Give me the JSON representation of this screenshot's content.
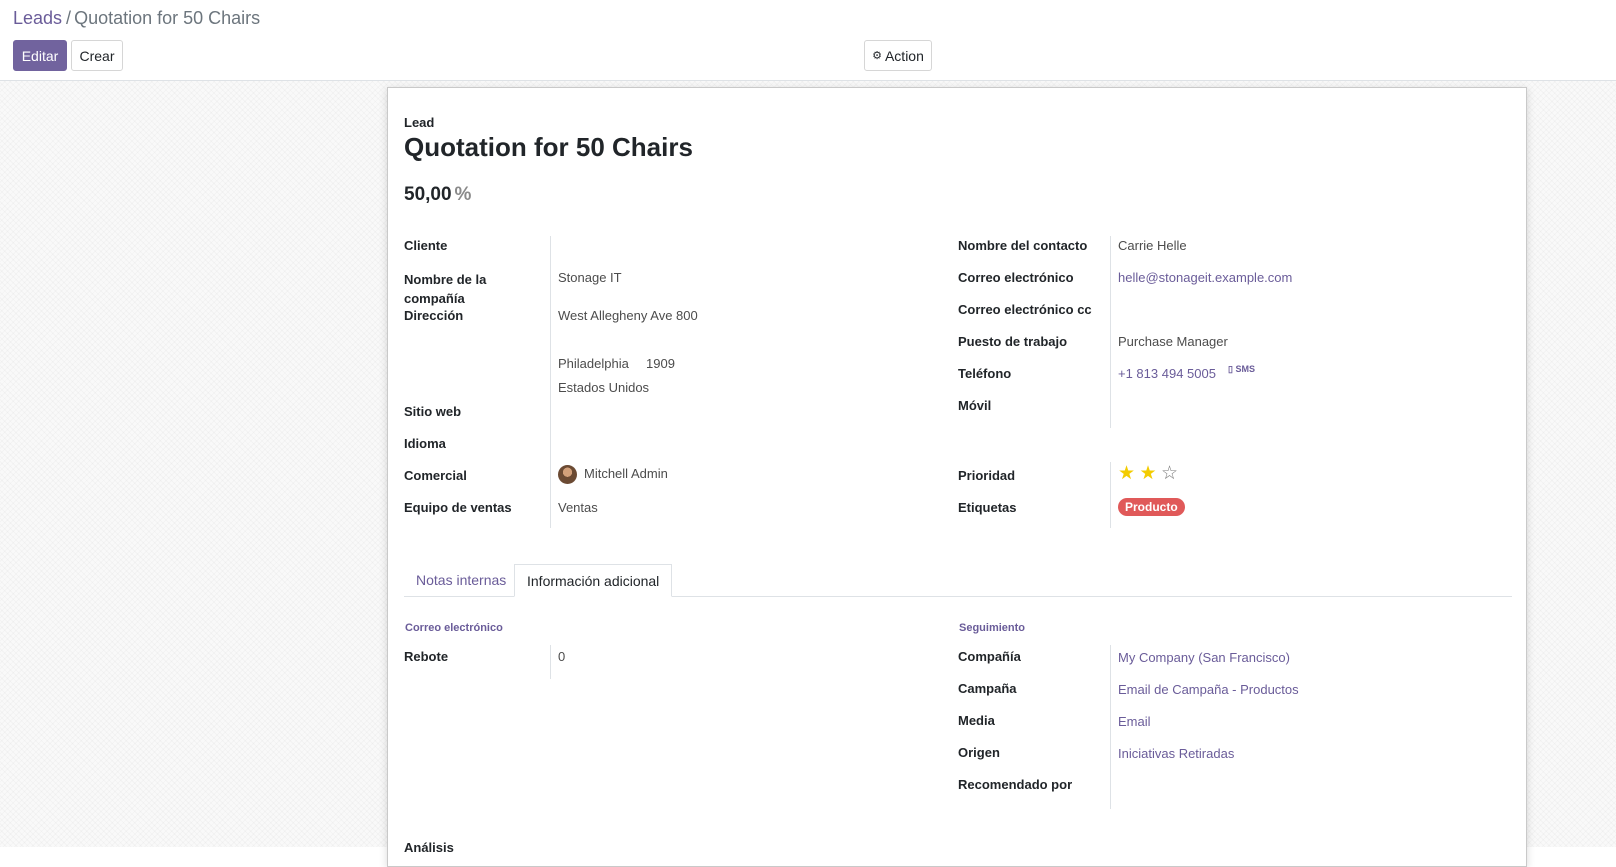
{
  "breadcrumb": {
    "parent": "Leads",
    "separator": "/",
    "current": "Quotation for 50 Chairs"
  },
  "toolbar": {
    "edit_label": "Editar",
    "create_label": "Crear",
    "action_label": "Action",
    "action_icon": "gear-icon"
  },
  "record": {
    "type_label": "Lead",
    "title": "Quotation for 50 Chairs",
    "probability": "50,00",
    "probability_unit": "%"
  },
  "left_fields": {
    "customer_label": "Cliente",
    "customer_value": "",
    "company_name_label": "Nombre de la compañía",
    "company_name_value": "Stonage IT",
    "address_label": "Dirección",
    "street": "West Allegheny Ave 800",
    "city": "Philadelphia",
    "zip": "1909",
    "country": "Estados Unidos",
    "website_label": "Sitio web",
    "website_value": "",
    "language_label": "Idioma",
    "language_value": "",
    "salesperson_label": "Comercial",
    "salesperson_value": "Mitchell Admin",
    "sales_team_label": "Equipo de ventas",
    "sales_team_value": "Ventas"
  },
  "right_fields": {
    "contact_label": "Nombre del contacto",
    "contact_value": "Carrie Helle",
    "email_label": "Correo electrónico",
    "email_value": "helle@stonageit.example.com",
    "email_cc_label": "Correo electrónico cc",
    "email_cc_value": "",
    "job_label": "Puesto de trabajo",
    "job_value": "Purchase Manager",
    "phone_label": "Teléfono",
    "phone_value": "+1 813 494 5005",
    "sms_label": "SMS",
    "mobile_label": "Móvil",
    "mobile_value": "",
    "priority_label": "Prioridad",
    "priority_stars": 2,
    "priority_max": 3,
    "tags_label": "Etiquetas",
    "tag_value": "Producto",
    "tag_color": "#e05959"
  },
  "tabs": {
    "notes_label": "Notas internas",
    "info_label": "Información adicional"
  },
  "email_section": {
    "title": "Correo electrónico",
    "bounce_label": "Rebote",
    "bounce_value": "0"
  },
  "tracking_section": {
    "title": "Seguimiento",
    "company_label": "Compañía",
    "company_value": "My Company (San Francisco)",
    "campaign_label": "Campaña",
    "campaign_value": "Email de Campaña - Productos",
    "medium_label": "Media",
    "medium_value": "Email",
    "source_label": "Origen",
    "source_value": "Iniciativas Retiradas",
    "referred_label": "Recomendado por",
    "referred_value": ""
  },
  "next_section_partial": "Análisis",
  "colors": {
    "primary": "#71639e",
    "link": "#6a5c99",
    "star_active": "#f3cc00",
    "tag": "#e05959"
  }
}
